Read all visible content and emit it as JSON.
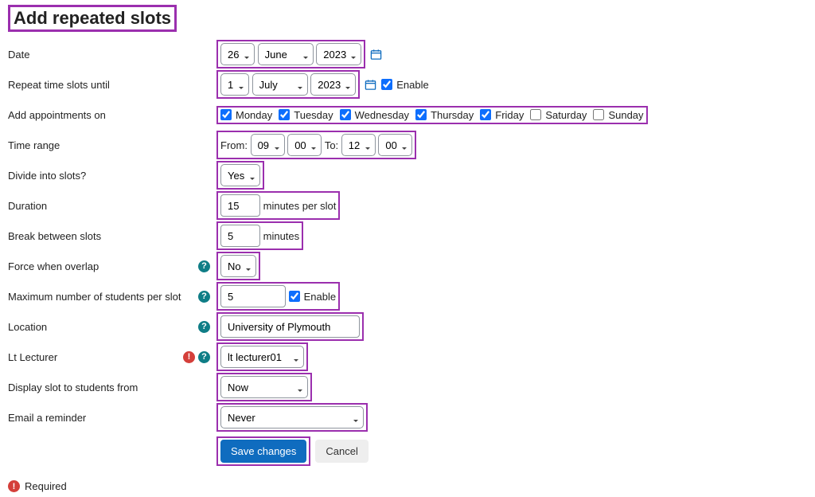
{
  "title": "Add repeated slots",
  "labels": {
    "date": "Date",
    "repeat_until": "Repeat time slots until",
    "add_on": "Add appointments on",
    "time_range": "Time range",
    "divide": "Divide into slots?",
    "duration": "Duration",
    "break": "Break between slots",
    "force": "Force when overlap",
    "max_students": "Maximum number of students per slot",
    "location": "Location",
    "lecturer": "Lt Lecturer",
    "display_from": "Display slot to students from",
    "email": "Email a reminder"
  },
  "date": {
    "day": "26",
    "month": "June",
    "year": "2023"
  },
  "repeat_until": {
    "day": "1",
    "month": "July",
    "year": "2023",
    "enable_label": "Enable",
    "enable_checked": true
  },
  "days": [
    {
      "name": "Monday",
      "checked": true
    },
    {
      "name": "Tuesday",
      "checked": true
    },
    {
      "name": "Wednesday",
      "checked": true
    },
    {
      "name": "Thursday",
      "checked": true
    },
    {
      "name": "Friday",
      "checked": true
    },
    {
      "name": "Saturday",
      "checked": false
    },
    {
      "name": "Sunday",
      "checked": false
    }
  ],
  "time_range": {
    "from_label": "From:",
    "from_h": "09",
    "from_m": "00",
    "to_label": "To:",
    "to_h": "12",
    "to_m": "00"
  },
  "divide": "Yes",
  "duration": {
    "value": "15",
    "suffix": "minutes per slot"
  },
  "break_between": {
    "value": "5",
    "suffix": "minutes"
  },
  "force": "No",
  "max_students": {
    "value": "5",
    "enable_label": "Enable",
    "enable_checked": true
  },
  "location": "University of Plymouth",
  "lecturer": "lt lecturer01",
  "display_from": "Now",
  "email_reminder": "Never",
  "buttons": {
    "save": "Save changes",
    "cancel": "Cancel"
  },
  "footer_required": "Required",
  "colors": {
    "highlight": "#9b2fae",
    "primary": "#0f6cbf",
    "help": "#0f7d86",
    "required": "#d43f3a"
  }
}
